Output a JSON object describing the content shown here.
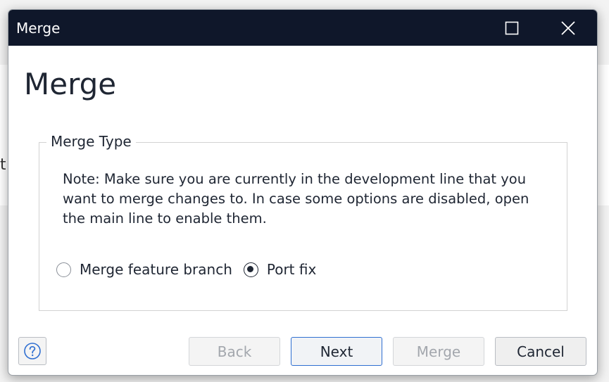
{
  "window": {
    "title": "Merge",
    "maximize_icon": "maximize-icon",
    "close_icon": "close-icon"
  },
  "page": {
    "heading": "Merge"
  },
  "merge_type": {
    "legend": "Merge Type",
    "note": "Note: Make sure you are currently in the development line that you want to merge changes to. In case some options are disabled, open the main line to enable them.",
    "options": [
      {
        "label": "Merge feature branch",
        "selected": false
      },
      {
        "label": "Port fix",
        "selected": true
      }
    ]
  },
  "footer": {
    "help_icon": "help-icon",
    "buttons": {
      "back": "Back",
      "next": "Next",
      "merge": "Merge",
      "cancel": "Cancel"
    }
  },
  "colors": {
    "titlebar": "#0f172a",
    "primary_border": "#2f6fd1",
    "help_icon": "#2f6fd1"
  }
}
